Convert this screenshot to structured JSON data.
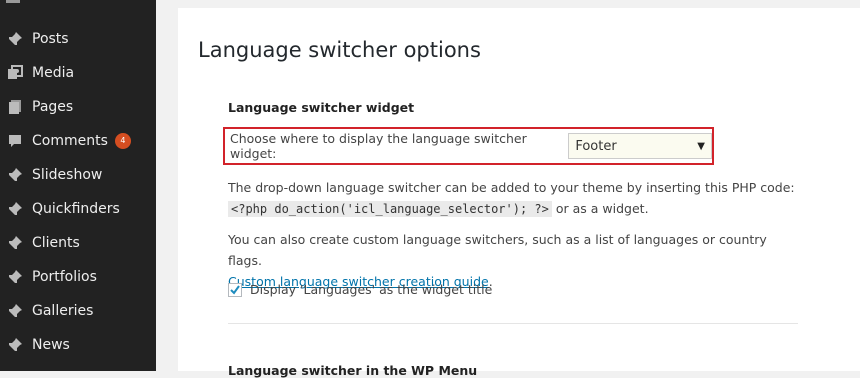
{
  "sidebar": {
    "items": [
      {
        "label": "Posts",
        "icon": "pushpin-icon"
      },
      {
        "label": "Media",
        "icon": "media-icon"
      },
      {
        "label": "Pages",
        "icon": "pages-icon"
      },
      {
        "label": "Comments",
        "icon": "comment-icon",
        "badge": "4"
      },
      {
        "label": "Slideshow",
        "icon": "pushpin-icon"
      },
      {
        "label": "Quickfinders",
        "icon": "pushpin-icon"
      },
      {
        "label": "Clients",
        "icon": "pushpin-icon"
      },
      {
        "label": "Portfolios",
        "icon": "pushpin-icon"
      },
      {
        "label": "Galleries",
        "icon": "pushpin-icon"
      },
      {
        "label": "News",
        "icon": "pushpin-icon"
      }
    ]
  },
  "main": {
    "title": "Language switcher options",
    "widget_section": {
      "heading": "Language switcher widget",
      "choose_label": "Choose where to display the language switcher widget:",
      "selected_value": "Footer",
      "php_text_before": "The drop-down language switcher can be added to your theme by inserting this PHP code:",
      "php_code": "<?php do_action('icl_language_selector'); ?>",
      "php_text_after": "or as a widget.",
      "custom_text": "You can also create custom language switchers, such as a list of languages or country flags.",
      "guide_link": "Custom language switcher creation guide",
      "guide_link_suffix": ".",
      "checkbox_label": "Display 'Languages' as the widget title",
      "checkbox_checked": true
    },
    "next_section_heading": "Language switcher in the WP Menu"
  },
  "colors": {
    "sidebar_bg": "#222222",
    "highlight_border": "#d2232a",
    "badge": "#d54e21",
    "link": "#0073aa"
  }
}
